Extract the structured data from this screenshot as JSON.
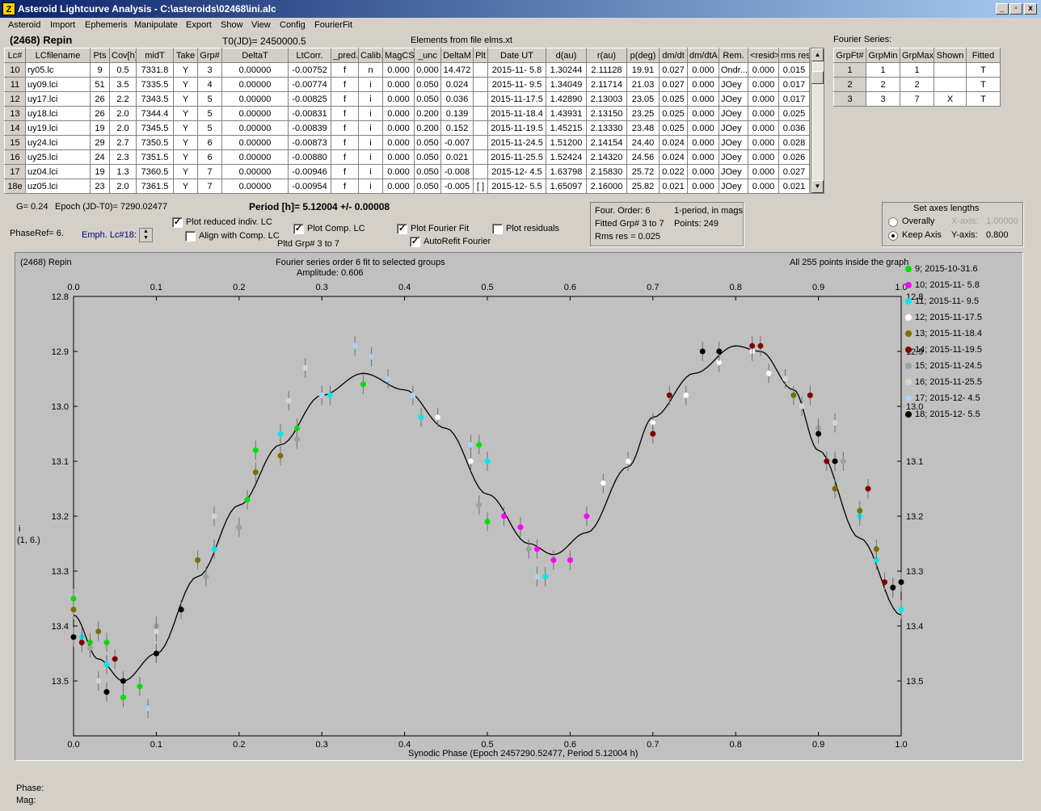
{
  "window": {
    "title": "Asteroid Lightcurve Analysis - C:\\asteroids\\02468\\ini.alc",
    "icon_glyph": "Z",
    "min": "_",
    "max": "▫",
    "close": "x"
  },
  "menu": [
    "Asteroid",
    "Import",
    "Ephemeris",
    "Manipulate",
    "Export",
    "Show",
    "View",
    "Config",
    "FourierFit"
  ],
  "header": {
    "asteroid": "(2468) Repin",
    "t0": "T0(JD)= 2450000.5",
    "elements": "Elements from file elms.xt"
  },
  "lc_table": {
    "columns": [
      "Lc#",
      "LCfilename",
      "Pts",
      "Cov[h]",
      "midT",
      "Take",
      "Grp#",
      "DeltaT",
      "LtCorr.",
      "_pred.",
      "Calib.",
      "MagCS",
      "_unc",
      "DeltaM",
      "Plt",
      "Date UT",
      "d(au)",
      "r(au)",
      "p(deg)",
      "dm/dt",
      "dm/dtA",
      "Rem.",
      "<resid>",
      "rms res"
    ],
    "rows": [
      [
        "10",
        "ry05.lc",
        "9",
        "0.5",
        "7331.8",
        "Y",
        "3",
        "0.00000",
        "-0.00752",
        "f",
        "n",
        "0.000",
        "0.000",
        "14.472",
        "",
        "2015-11- 5.8",
        "1.30244",
        "2.11128",
        "19.91",
        "0.027",
        "0.000",
        "Ondr...",
        "0.000",
        "0.015"
      ],
      [
        "11",
        "uy09.lci",
        "51",
        "3.5",
        "7335.5",
        "Y",
        "4",
        "0.00000",
        "-0.00774",
        "f",
        "i",
        "0.000",
        "0.050",
        "0.024",
        "",
        "2015-11- 9.5",
        "1.34049",
        "2.11714",
        "21.03",
        "0.027",
        "0.000",
        "JOey",
        "0.000",
        "0.017"
      ],
      [
        "12",
        "uy17.lci",
        "26",
        "2.2",
        "7343.5",
        "Y",
        "5",
        "0.00000",
        "-0.00825",
        "f",
        "i",
        "0.000",
        "0.050",
        "0.036",
        "",
        "2015-11-17.5",
        "1.42890",
        "2.13003",
        "23.05",
        "0.025",
        "0.000",
        "JOey",
        "0.000",
        "0.017"
      ],
      [
        "13",
        "uy18.lci",
        "26",
        "2.0",
        "7344.4",
        "Y",
        "5",
        "0.00000",
        "-0.00831",
        "f",
        "i",
        "0.000",
        "0.200",
        "0.139",
        "",
        "2015-11-18.4",
        "1.43931",
        "2.13150",
        "23.25",
        "0.025",
        "0.000",
        "JOey",
        "0.000",
        "0.025"
      ],
      [
        "14",
        "uy19.lci",
        "19",
        "2.0",
        "7345.5",
        "Y",
        "5",
        "0.00000",
        "-0.00839",
        "f",
        "i",
        "0.000",
        "0.200",
        "0.152",
        "",
        "2015-11-19.5",
        "1.45215",
        "2.13330",
        "23.48",
        "0.025",
        "0.000",
        "JOey",
        "0.000",
        "0.036"
      ],
      [
        "15",
        "uy24.lci",
        "29",
        "2.7",
        "7350.5",
        "Y",
        "6",
        "0.00000",
        "-0.00873",
        "f",
        "i",
        "0.000",
        "0.050",
        "-0.007",
        "",
        "2015-11-24.5",
        "1.51200",
        "2.14154",
        "24.40",
        "0.024",
        "0.000",
        "JOey",
        "0.000",
        "0.028"
      ],
      [
        "16",
        "uy25.lci",
        "24",
        "2.3",
        "7351.5",
        "Y",
        "6",
        "0.00000",
        "-0.00880",
        "f",
        "i",
        "0.000",
        "0.050",
        "0.021",
        "",
        "2015-11-25.5",
        "1.52424",
        "2.14320",
        "24.56",
        "0.024",
        "0.000",
        "JOey",
        "0.000",
        "0.026"
      ],
      [
        "17",
        "uz04.lci",
        "19",
        "1.3",
        "7360.5",
        "Y",
        "7",
        "0.00000",
        "-0.00946",
        "f",
        "i",
        "0.000",
        "0.050",
        "-0.008",
        "",
        "2015-12- 4.5",
        "1.63798",
        "2.15830",
        "25.72",
        "0.022",
        "0.000",
        "JOey",
        "0.000",
        "0.027"
      ],
      [
        "18e",
        "uz05.lci",
        "23",
        "2.0",
        "7361.5",
        "Y",
        "7",
        "0.00000",
        "-0.00954",
        "f",
        "i",
        "0.000",
        "0.050",
        "-0.005",
        "[ ]",
        "2015-12- 5.5",
        "1.65097",
        "2.16000",
        "25.82",
        "0.021",
        "0.000",
        "JOey",
        "0.000",
        "0.021"
      ]
    ]
  },
  "fourier_series": {
    "title": "Fourier Series:",
    "columns": [
      "GrpFt#",
      "GrpMin",
      "GrpMax",
      "Shown",
      "Fitted"
    ],
    "rows": [
      [
        "1",
        "1",
        "1",
        "",
        "T"
      ],
      [
        "2",
        "2",
        "2",
        "",
        "T"
      ],
      [
        "3",
        "3",
        "7",
        "X",
        "T"
      ]
    ]
  },
  "info": {
    "g": "G= 0.24",
    "epoch": "Epoch (JD-T0)= 7290.02477",
    "period": "Period [h]= 5.12004 +/- 0.00008",
    "phaseref": "PhaseRef= 6.",
    "emph": "Emph. Lc#18:",
    "plot_reduced": "Plot reduced indiv. LC",
    "align_comp": "Align with Comp. LC",
    "plot_comp": "Plot Comp. LC",
    "pltd_grp": "Pltd Grp#  3  to  7",
    "plot_fourier": "Plot Fourier Fit",
    "autorefit": "AutoRefit Fourier",
    "plot_residuals": "Plot residuals",
    "four_order": "Four. Order:  6",
    "one_period": "1-period, in mags",
    "fitted_grp": "Fitted Grp# 3 to 7",
    "points": "Points: 249",
    "rms": "Rms res     = 0.025",
    "axes_title": "Set axes lengths",
    "overally": "Overally",
    "keep_axis": "Keep Axis",
    "xaxis_lbl": "X-axis:",
    "xaxis_val": "1.00000",
    "yaxis_lbl": "Y-axis:",
    "yaxis_val": "0.800"
  },
  "plot": {
    "left_title": "(2468) Repin",
    "center_title": "Fourier series order 6 fit to selected groups",
    "amplitude": "Amplitude: 0.606",
    "right_title": "All 255 points inside the graph",
    "ylabel": "i",
    "ylabel2": "(1, 6.)",
    "xlabel": "Synodic Phase (Epoch 2457290.52477, Period 5.12004 h)",
    "x_ticks": [
      "0.0",
      "0.1",
      "0.2",
      "0.3",
      "0.4",
      "0.5",
      "0.6",
      "0.7",
      "0.8",
      "0.9",
      "1.0"
    ],
    "y_ticks": [
      "12.8",
      "12.9",
      "13.0",
      "13.1",
      "13.2",
      "13.3",
      "13.4",
      "13.5"
    ],
    "legend": [
      {
        "label": "9; 2015-10-31.6",
        "color": "#00e000"
      },
      {
        "label": "10; 2015-11- 5.8",
        "color": "#ff00ff"
      },
      {
        "label": "11; 2015-11- 9.5",
        "color": "#00e8f0"
      },
      {
        "label": "12; 2015-11-17.5",
        "color": "#ffffff"
      },
      {
        "label": "13; 2015-11-18.4",
        "color": "#7a7000"
      },
      {
        "label": "14; 2015-11-19.5",
        "color": "#800000"
      },
      {
        "label": "15; 2015-11-24.5",
        "color": "#a0a0a0"
      },
      {
        "label": "16; 2015-11-25.5",
        "color": "#c8dcc8"
      },
      {
        "label": "17; 2015-12- 4.5",
        "color": "#b0d0f0"
      },
      {
        "label": "18; 2015-12- 5.5",
        "color": "#000000"
      }
    ]
  },
  "status": {
    "phase": "Phase:",
    "mag": "Mag:"
  },
  "chart_data": {
    "type": "scatter",
    "title": "Fourier series order 6 fit to selected groups",
    "xlabel": "Synodic Phase (Epoch 2457290.52477, Period 5.12004 h)",
    "ylabel": "i",
    "xlim": [
      0,
      1
    ],
    "ylim": [
      13.6,
      12.8
    ],
    "y_inverted": true,
    "fit_curve": {
      "x": [
        0.0,
        0.03,
        0.06,
        0.1,
        0.15,
        0.2,
        0.25,
        0.3,
        0.35,
        0.4,
        0.45,
        0.5,
        0.55,
        0.58,
        0.62,
        0.67,
        0.7,
        0.75,
        0.8,
        0.83,
        0.87,
        0.9,
        0.95,
        1.0
      ],
      "y": [
        13.38,
        13.46,
        13.5,
        13.45,
        13.31,
        13.18,
        13.07,
        12.98,
        12.94,
        12.97,
        13.04,
        13.16,
        13.25,
        13.27,
        13.23,
        13.11,
        13.02,
        12.94,
        12.89,
        12.9,
        12.97,
        13.08,
        13.24,
        13.38
      ]
    },
    "series": [
      {
        "name": "9; 2015-10-31.6",
        "x": [
          0.0,
          0.02,
          0.04,
          0.06,
          0.08,
          0.21,
          0.22,
          0.27,
          0.35,
          0.49,
          0.5
        ],
        "y": [
          13.35,
          13.43,
          13.43,
          13.53,
          13.51,
          13.17,
          13.08,
          13.04,
          12.96,
          13.07,
          13.21
        ]
      },
      {
        "name": "10; 2015-11- 5.8",
        "x": [
          0.52,
          0.54,
          0.56,
          0.58,
          0.6,
          0.62
        ],
        "y": [
          13.2,
          13.22,
          13.26,
          13.28,
          13.28,
          13.2
        ]
      },
      {
        "name": "11; 2015-11- 9.5",
        "x": [
          0.01,
          0.04,
          0.1,
          0.17,
          0.25,
          0.31,
          0.42,
          0.5,
          0.57,
          0.95,
          0.97,
          1.0
        ],
        "y": [
          13.42,
          13.47,
          13.45,
          13.26,
          13.05,
          12.98,
          13.02,
          13.1,
          13.31,
          13.2,
          13.28,
          13.37
        ]
      },
      {
        "name": "12; 2015-11-17.5",
        "x": [
          0.44,
          0.48,
          0.64,
          0.67,
          0.7,
          0.74,
          0.78,
          0.82,
          0.84
        ],
        "y": [
          13.02,
          13.1,
          13.14,
          13.1,
          13.03,
          12.98,
          12.92,
          12.9,
          12.94
        ]
      },
      {
        "name": "13; 2015-11-18.4",
        "x": [
          0.0,
          0.03,
          0.15,
          0.22,
          0.25,
          0.87,
          0.92,
          0.95,
          0.97
        ],
        "y": [
          13.37,
          13.41,
          13.28,
          13.12,
          13.09,
          12.98,
          13.15,
          13.19,
          13.26
        ]
      },
      {
        "name": "14; 2015-11-19.5",
        "x": [
          0.01,
          0.05,
          0.7,
          0.72,
          0.82,
          0.83,
          0.89,
          0.91,
          0.96,
          0.98
        ],
        "y": [
          13.43,
          13.46,
          13.05,
          12.98,
          12.89,
          12.89,
          12.98,
          13.1,
          13.15,
          13.32
        ]
      },
      {
        "name": "15; 2015-11-24.5",
        "x": [
          0.02,
          0.1,
          0.16,
          0.2,
          0.27,
          0.49,
          0.55,
          0.9,
          0.93,
          0.99
        ],
        "y": [
          13.44,
          13.4,
          13.31,
          13.22,
          13.06,
          13.18,
          13.26,
          13.04,
          13.1,
          13.33
        ]
      },
      {
        "name": "16; 2015-11-25.5",
        "x": [
          0.03,
          0.1,
          0.17,
          0.26,
          0.28,
          0.86,
          0.88,
          0.92
        ],
        "y": [
          13.5,
          13.41,
          13.2,
          12.99,
          12.93,
          12.95,
          13.0,
          13.03
        ]
      },
      {
        "name": "17; 2015-12- 4.5",
        "x": [
          0.09,
          0.3,
          0.34,
          0.36,
          0.38,
          0.41,
          0.48,
          0.56
        ],
        "y": [
          13.55,
          12.98,
          12.89,
          12.91,
          12.95,
          12.98,
          13.07,
          13.31
        ]
      },
      {
        "name": "18; 2015-12- 5.5",
        "x": [
          0.0,
          0.04,
          0.06,
          0.1,
          0.13,
          0.76,
          0.78,
          0.9,
          0.92,
          0.99,
          1.0
        ],
        "y": [
          13.42,
          13.52,
          13.5,
          13.45,
          13.37,
          12.9,
          12.9,
          13.05,
          13.1,
          13.33,
          13.32
        ]
      }
    ]
  }
}
